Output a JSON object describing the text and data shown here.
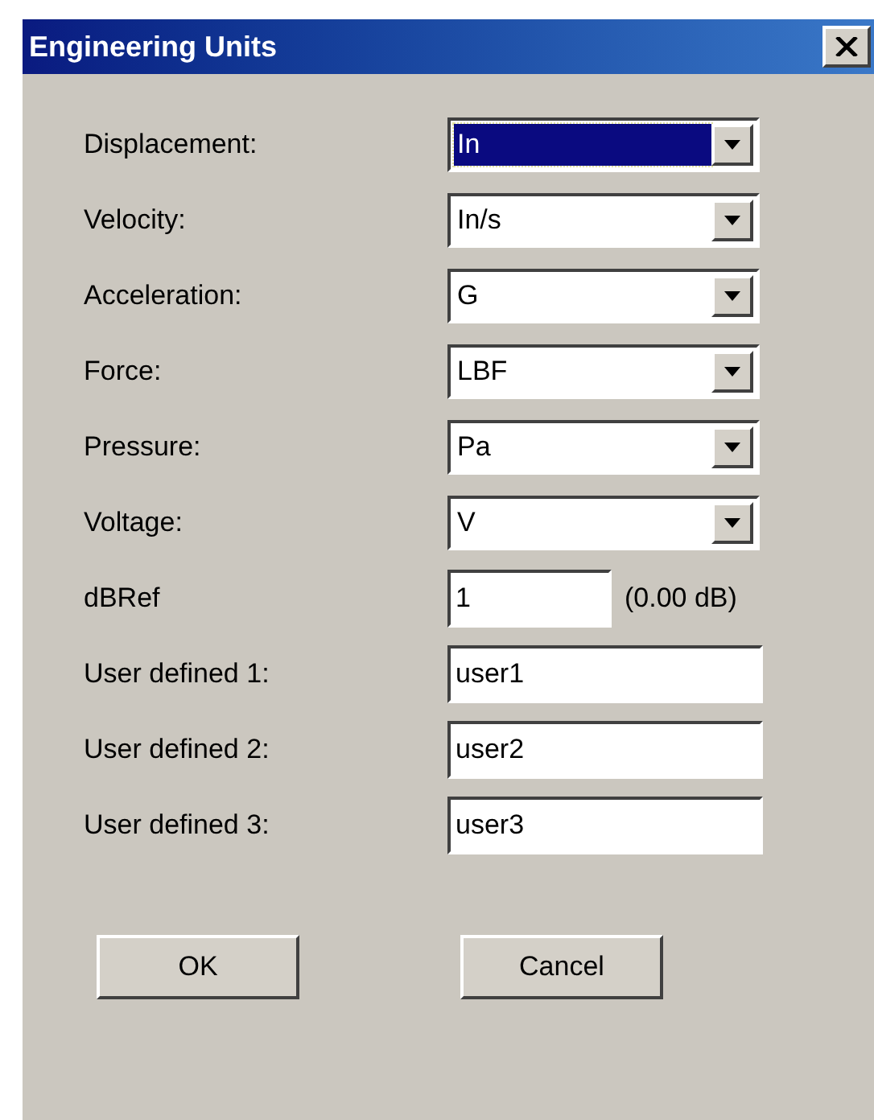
{
  "window": {
    "title": "Engineering Units"
  },
  "fields": [
    {
      "label": "Displacement:",
      "kind": "dropdown",
      "value": "In",
      "focused": true
    },
    {
      "label": "Velocity:",
      "kind": "dropdown",
      "value": "In/s",
      "focused": false
    },
    {
      "label": "Acceleration:",
      "kind": "dropdown",
      "value": "G",
      "focused": false
    },
    {
      "label": "Force:",
      "kind": "dropdown",
      "value": "LBF",
      "focused": false
    },
    {
      "label": "Pressure:",
      "kind": "dropdown",
      "value": "Pa",
      "focused": false
    },
    {
      "label": "Voltage:",
      "kind": "dropdown",
      "value": "V",
      "focused": false
    },
    {
      "label": "dBRef",
      "kind": "short_text",
      "value": "1",
      "suffix": "(0.00 dB)",
      "focused": false
    },
    {
      "label": "User defined 1:",
      "kind": "text",
      "value": "user1",
      "focused": false
    },
    {
      "label": "User defined 2:",
      "kind": "text",
      "value": "user2",
      "focused": false
    },
    {
      "label": "User defined 3:",
      "kind": "text",
      "value": "user3",
      "focused": false
    }
  ],
  "buttons": [
    "OK",
    "Cancel"
  ]
}
